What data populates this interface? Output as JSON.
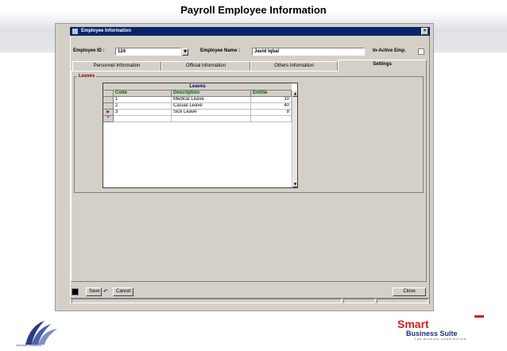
{
  "slide": {
    "title": "Payroll  Employee Information"
  },
  "window": {
    "title": "Employee Information",
    "close_glyph": "×"
  },
  "form": {
    "employee_id_label": "Employee ID :",
    "employee_id_value": "124",
    "employee_name_label": "Employee Name :",
    "employee_name_value": "Javid Iqbal",
    "inactive_label": "In-Active Emp.",
    "inactive_checked": false
  },
  "tabs": [
    {
      "label": "Personnel Information",
      "active": false
    },
    {
      "label": "Official Information",
      "active": false
    },
    {
      "label": "Others Information",
      "active": false
    },
    {
      "label": "Settings",
      "active": true
    }
  ],
  "leaves_group": {
    "label": "Leaves",
    "grid_caption": "Leaves",
    "columns": [
      "Code",
      "Description",
      "Entitle"
    ],
    "rows": [
      {
        "code": "1",
        "description": "Medical Leave",
        "entitle": "10",
        "marker": ""
      },
      {
        "code": "2",
        "description": "Casual Leave",
        "entitle": "40",
        "marker": ""
      },
      {
        "code": "3",
        "description": "Sick Leave",
        "entitle": "8",
        "marker": "▶"
      },
      {
        "code": "",
        "description": "",
        "entitle": "",
        "marker": "*"
      }
    ]
  },
  "toolbar": {
    "save_label": "Save",
    "cancel_label": "Cancel",
    "close_label": "Close"
  },
  "logos": {
    "left_caption": "Genesis Solutions",
    "right_smart": "Smart",
    "right_suite": "Business Suite",
    "right_tagline": "THE WINNING COMBINATION"
  },
  "colors": {
    "title_bar": "#0a246a",
    "group_label": "#800000",
    "column_header": "#006400",
    "brand_red": "#d1201c",
    "brand_blue": "#1e2f75"
  }
}
